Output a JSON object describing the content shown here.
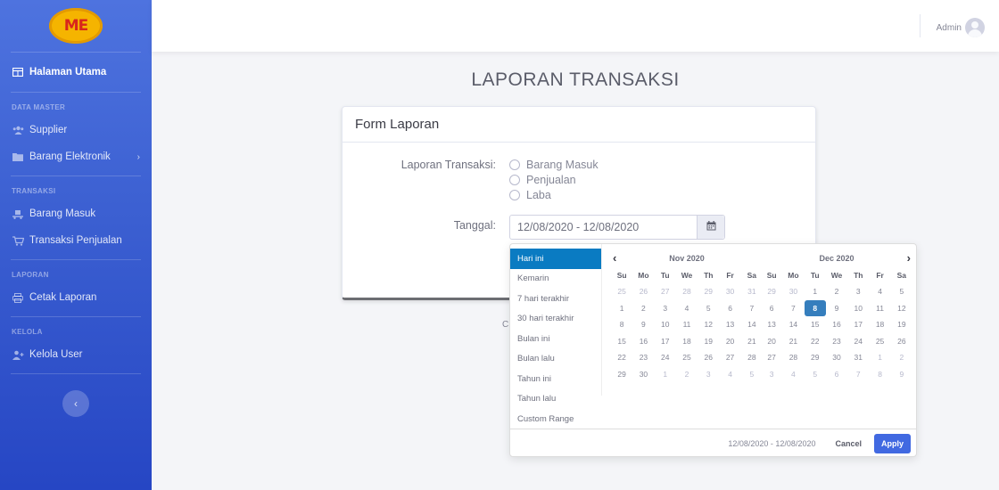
{
  "sidebar": {
    "logo": "ME",
    "home_label": "Halaman Utama",
    "sections": {
      "master": "DATA MASTER",
      "transaksi": "TRANSAKSI",
      "laporan": "LAPORAN",
      "kelola": "KELOLA"
    },
    "items": {
      "supplier": "Supplier",
      "barang_elektronik": "Barang Elektronik",
      "barang_masuk": "Barang Masuk",
      "transaksi_penjualan": "Transaksi Penjualan",
      "cetak_laporan": "Cetak Laporan",
      "kelola_user": "Kelola User"
    },
    "toggle_glyph": "‹"
  },
  "topbar": {
    "user_name": "Admin"
  },
  "page_title": "LAPORAN TRANSAKSI",
  "form": {
    "header": "Form Laporan",
    "jenis_label": "Laporan Transaksi:",
    "options": [
      "Barang Masuk",
      "Penjualan",
      "Laba"
    ],
    "tanggal_label": "Tanggal:",
    "tanggal_value": "12/08/2020 - 12/08/2020"
  },
  "footer_fragment": "C",
  "picker": {
    "ranges": [
      "Hari ini",
      "Kemarin",
      "7 hari terakhir",
      "30 hari terakhir",
      "Bulan ini",
      "Bulan lalu",
      "Tahun ini",
      "Tahun lalu",
      "Custom Range"
    ],
    "active_range": "Hari ini",
    "weekdays": [
      "Su",
      "Mo",
      "Tu",
      "We",
      "Th",
      "Fr",
      "Sa"
    ],
    "left": {
      "month": "Nov 2020",
      "weeks": [
        [
          "25",
          "26",
          "27",
          "28",
          "29",
          "30",
          "31"
        ],
        [
          "1",
          "2",
          "3",
          "4",
          "5",
          "6",
          "7"
        ],
        [
          "8",
          "9",
          "10",
          "11",
          "12",
          "13",
          "14"
        ],
        [
          "15",
          "16",
          "17",
          "18",
          "19",
          "20",
          "21"
        ],
        [
          "22",
          "23",
          "24",
          "25",
          "26",
          "27",
          "28"
        ],
        [
          "29",
          "30",
          "1",
          "2",
          "3",
          "4",
          "5"
        ]
      ]
    },
    "right": {
      "month": "Dec 2020",
      "weeks": [
        [
          "29",
          "30",
          "1",
          "2",
          "3",
          "4",
          "5"
        ],
        [
          "6",
          "7",
          "8",
          "9",
          "10",
          "11",
          "12"
        ],
        [
          "13",
          "14",
          "15",
          "16",
          "17",
          "18",
          "19"
        ],
        [
          "20",
          "21",
          "22",
          "23",
          "24",
          "25",
          "26"
        ],
        [
          "27",
          "28",
          "29",
          "30",
          "31",
          "1",
          "2"
        ],
        [
          "3",
          "4",
          "5",
          "6",
          "7",
          "8",
          "9"
        ]
      ]
    },
    "selected_text": "12/08/2020 - 12/08/2020",
    "cancel_label": "Cancel",
    "apply_label": "Apply",
    "prev_glyph": "‹",
    "next_glyph": "›"
  },
  "colors": {
    "sidebar_top": "#4e73df",
    "sidebar_bottom": "#2646c4",
    "range_active": "#0a7bc2",
    "day_selected": "#357ebd",
    "apply_button": "#4169e1"
  },
  "icons": {
    "home": "table-icon",
    "supplier": "users-icon",
    "barang_elektronik": "folder-icon",
    "barang_masuk": "dolly-icon",
    "penjualan": "cart-icon",
    "cetak": "print-icon",
    "kelola": "user-plus-icon",
    "calendar": "calendar-icon"
  }
}
